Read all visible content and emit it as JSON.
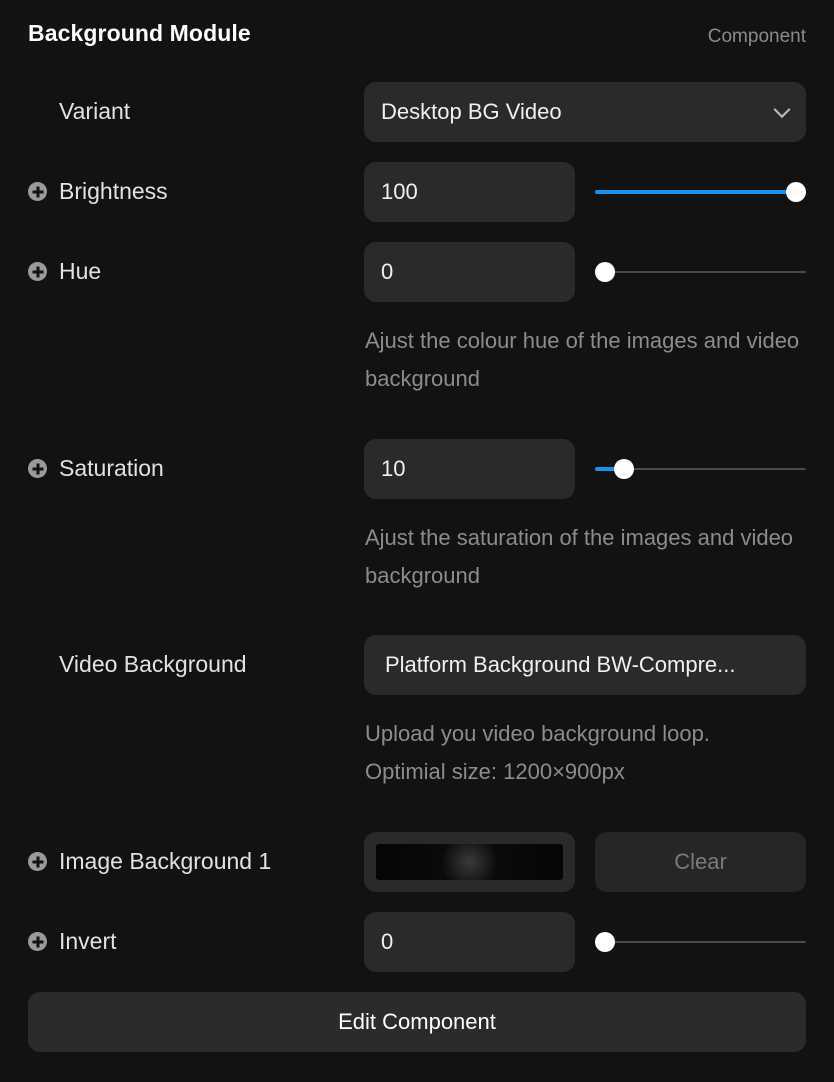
{
  "panel": {
    "title": "Background Module",
    "type_label": "Component"
  },
  "variant": {
    "label": "Variant",
    "value": "Desktop BG Video",
    "icon": "chevron-down-icon"
  },
  "brightness": {
    "label": "Brightness",
    "value": "100",
    "slider_level": 1.0
  },
  "hue": {
    "label": "Hue",
    "value": "0",
    "slider_level": 0.0,
    "help": "Ajust the colour hue of the images and video background"
  },
  "saturation": {
    "label": "Saturation",
    "value": "10",
    "slider_level": 0.1,
    "help": "Ajust the saturation of the images and video background"
  },
  "video_background": {
    "label": "Video Background",
    "file_name": "Platform Background BW-Compre...",
    "help_line1": "Upload you video background loop.",
    "help_line2": "Optimial size: 1200×900px"
  },
  "image_background": {
    "label": "Image Background 1",
    "clear_label": "Clear"
  },
  "invert": {
    "label": "Invert",
    "value": "0",
    "slider_level": 0.0
  },
  "footer": {
    "edit_label": "Edit Component"
  },
  "colors": {
    "accent": "#1e8fe6",
    "background": "#121212",
    "field": "#2a2a2a"
  }
}
